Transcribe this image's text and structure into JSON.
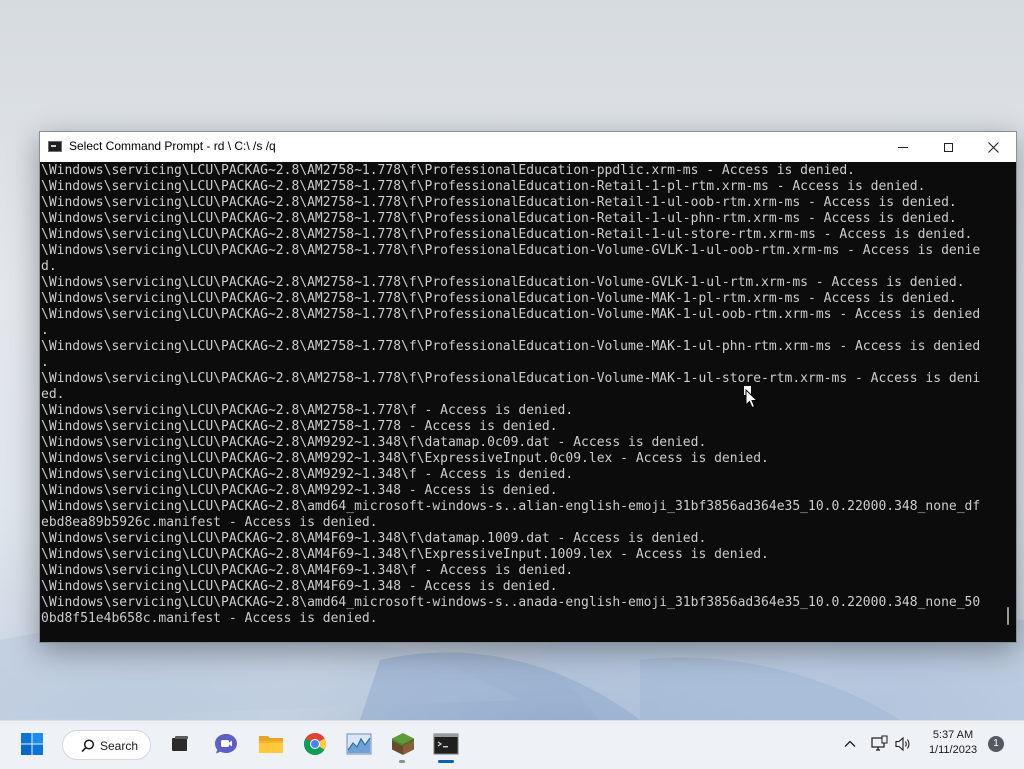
{
  "window": {
    "title": "Select Command Prompt - rd \\ C:\\ /s /q"
  },
  "console": {
    "lines": [
      "\\Windows\\servicing\\LCU\\PACKAG~2.8\\AM2758~1.778\\f\\ProfessionalEducation-ppdlic.xrm-ms - Access is denied.",
      "\\Windows\\servicing\\LCU\\PACKAG~2.8\\AM2758~1.778\\f\\ProfessionalEducation-Retail-1-pl-rtm.xrm-ms - Access is denied.",
      "\\Windows\\servicing\\LCU\\PACKAG~2.8\\AM2758~1.778\\f\\ProfessionalEducation-Retail-1-ul-oob-rtm.xrm-ms - Access is denied.",
      "\\Windows\\servicing\\LCU\\PACKAG~2.8\\AM2758~1.778\\f\\ProfessionalEducation-Retail-1-ul-phn-rtm.xrm-ms - Access is denied.",
      "\\Windows\\servicing\\LCU\\PACKAG~2.8\\AM2758~1.778\\f\\ProfessionalEducation-Retail-1-ul-store-rtm.xrm-ms - Access is denied.",
      "\\Windows\\servicing\\LCU\\PACKAG~2.8\\AM2758~1.778\\f\\ProfessionalEducation-Volume-GVLK-1-ul-oob-rtm.xrm-ms - Access is denie",
      "d.",
      "\\Windows\\servicing\\LCU\\PACKAG~2.8\\AM2758~1.778\\f\\ProfessionalEducation-Volume-GVLK-1-ul-rtm.xrm-ms - Access is denied.",
      "\\Windows\\servicing\\LCU\\PACKAG~2.8\\AM2758~1.778\\f\\ProfessionalEducation-Volume-MAK-1-pl-rtm.xrm-ms - Access is denied.",
      "\\Windows\\servicing\\LCU\\PACKAG~2.8\\AM2758~1.778\\f\\ProfessionalEducation-Volume-MAK-1-ul-oob-rtm.xrm-ms - Access is denied",
      ".",
      "\\Windows\\servicing\\LCU\\PACKAG~2.8\\AM2758~1.778\\f\\ProfessionalEducation-Volume-MAK-1-ul-phn-rtm.xrm-ms - Access is denied",
      ".",
      "\\Windows\\servicing\\LCU\\PACKAG~2.8\\AM2758~1.778\\f\\ProfessionalEducation-Volume-MAK-1-ul-store-rtm.xrm-ms - Access is deni",
      "ed.",
      "\\Windows\\servicing\\LCU\\PACKAG~2.8\\AM2758~1.778\\f - Access is denied.",
      "\\Windows\\servicing\\LCU\\PACKAG~2.8\\AM2758~1.778 - Access is denied.",
      "\\Windows\\servicing\\LCU\\PACKAG~2.8\\AM9292~1.348\\f\\datamap.0c09.dat - Access is denied.",
      "\\Windows\\servicing\\LCU\\PACKAG~2.8\\AM9292~1.348\\f\\ExpressiveInput.0c09.lex - Access is denied.",
      "\\Windows\\servicing\\LCU\\PACKAG~2.8\\AM9292~1.348\\f - Access is denied.",
      "\\Windows\\servicing\\LCU\\PACKAG~2.8\\AM9292~1.348 - Access is denied.",
      "\\Windows\\servicing\\LCU\\PACKAG~2.8\\amd64_microsoft-windows-s..alian-english-emoji_31bf3856ad364e35_10.0.22000.348_none_df",
      "ebd8ea89b5926c.manifest - Access is denied.",
      "\\Windows\\servicing\\LCU\\PACKAG~2.8\\AM4F69~1.348\\f\\datamap.1009.dat - Access is denied.",
      "\\Windows\\servicing\\LCU\\PACKAG~2.8\\AM4F69~1.348\\f\\ExpressiveInput.1009.lex - Access is denied.",
      "\\Windows\\servicing\\LCU\\PACKAG~2.8\\AM4F69~1.348\\f - Access is denied.",
      "\\Windows\\servicing\\LCU\\PACKAG~2.8\\AM4F69~1.348 - Access is denied.",
      "\\Windows\\servicing\\LCU\\PACKAG~2.8\\amd64_microsoft-windows-s..anada-english-emoji_31bf3856ad364e35_10.0.22000.348_none_50",
      "0bd8f51e4b658c.manifest - Access is denied."
    ]
  },
  "taskbar": {
    "search_label": "Search",
    "apps": [
      {
        "icon": "windows-start-icon"
      },
      {
        "icon": "task-view-icon"
      },
      {
        "icon": "teams-chat-icon"
      },
      {
        "icon": "file-explorer-icon"
      },
      {
        "icon": "chrome-icon"
      },
      {
        "icon": "resource-monitor-icon"
      },
      {
        "icon": "minecraft-icon"
      },
      {
        "icon": "command-prompt-icon"
      }
    ]
  },
  "tray": {
    "time": "5:37 AM",
    "date": "1/11/2023",
    "notification_count": "1"
  },
  "colors": {
    "console_bg": "#0c0c0c",
    "console_text": "#cccccc",
    "accent": "#005fb8"
  }
}
